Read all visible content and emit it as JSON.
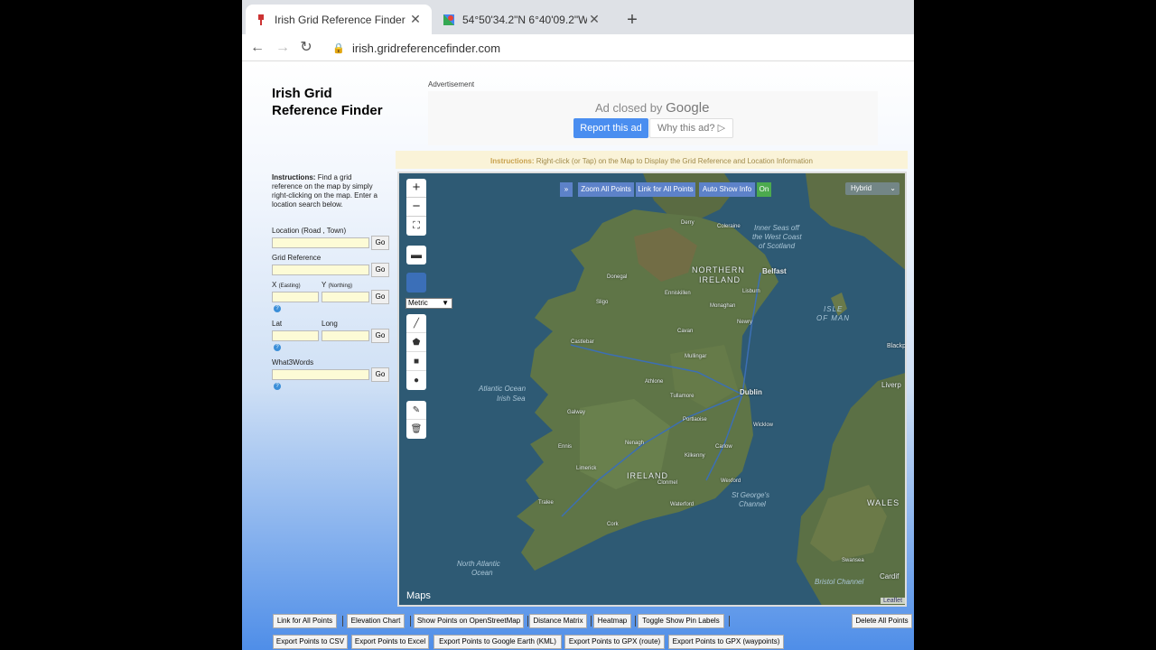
{
  "browser": {
    "tabs": [
      {
        "title": "Irish Grid Reference Finder",
        "active": true
      },
      {
        "title": "54°50'34.2\"N 6°40'09.2\"W - Goo",
        "active": false
      }
    ],
    "address": "irish.gridreferencefinder.com"
  },
  "site": {
    "title": "Irish Grid Reference Finder"
  },
  "ad": {
    "label": "Advertisement",
    "closed_text": "Ad closed by",
    "brand": "Google",
    "report": "Report this ad",
    "why": "Why this ad? ▷"
  },
  "instructions_bar": {
    "label": "Instructions:",
    "text": "Right-click (or Tap) on the Map to Display the Grid Reference and Location Information"
  },
  "left_panel": {
    "instructions_label": "Instructions:",
    "instructions_text": "Find a grid reference on the map by simply right-clicking on the map. Enter a location search below.",
    "location_label": "Location (Road , Town)",
    "grid_label": "Grid Reference",
    "x_label": "X",
    "x_sub": "(Easting)",
    "y_label": "Y",
    "y_sub": "(Northing)",
    "lat_label": "Lat",
    "long_label": "Long",
    "w3w_label": "What3Words",
    "go": "Go"
  },
  "map": {
    "zoom_all": "Zoom All Points",
    "link_all": "Link for All Points",
    "auto_show": "Auto Show Info",
    "on": "On",
    "expand": "»",
    "layer": "Hybrid",
    "metric": "Metric",
    "attribution_logo": "Maps",
    "attribution": "Leaflet",
    "labels": {
      "ni": "NORTHERN",
      "ni2": "IRELAND",
      "ireland": "IRELAND",
      "belfast": "Belfast",
      "dublin": "Dublin",
      "isle": "ISLE",
      "ofman": "OF MAN",
      "wales": "WALES",
      "inner_seas": "Inner Seas off",
      "inner_seas2": "the West Coast",
      "inner_seas3": "of Scotland",
      "atlantic": "Atlantic Ocean",
      "irish_sea": "Irish Sea",
      "st_george": "St George's",
      "channel": "Channel",
      "north_atlantic": "North Atlantic",
      "ocean": "Ocean",
      "bristol": "Bristol Channel",
      "cardif": "Cardif",
      "liverp": "Liverp",
      "blackp": "Blackp",
      "wicklow": "Wicklow",
      "kilkenny": "Kilkenny",
      "athlone": "Athlone",
      "tullamore": "Tullamore",
      "portlaoise": "Portlaoise",
      "donegal": "Donegal",
      "sligo": "Sligo",
      "derry": "Derry",
      "newry": "Newry",
      "cavan": "Cavan",
      "monaghan": "Monaghan",
      "galway": "Galway",
      "limerick": "Limerick",
      "cork": "Cork",
      "waterford": "Waterford",
      "wexford": "Wexford",
      "swansea": "Swansea",
      "castlebar": "Castlebar",
      "enniskillen": "Enniskillen",
      "coleraine": "Coleraine",
      "lisburn": "Lisburn",
      "carlow": "Carlow",
      "nenagh": "Nenagh",
      "mullingar": "Mullingar",
      "ennis": "Ennis",
      "tralee": "Tralee",
      "clonmel": "Clonmel"
    }
  },
  "bottom_buttons": {
    "row1": [
      "Link for All Points",
      "Elevation Chart",
      "Show Points on OpenStreetMap",
      "Distance Matrix",
      "Heatmap",
      "Toggle Show Pin Labels"
    ],
    "delete_all": "Delete All Points",
    "row2": [
      "Export Points to CSV",
      "Export Points to Excel",
      "Export Points to Google Earth (KML)",
      "Export Points to GPX (route)",
      "Export Points to GPX (waypoints)"
    ]
  }
}
